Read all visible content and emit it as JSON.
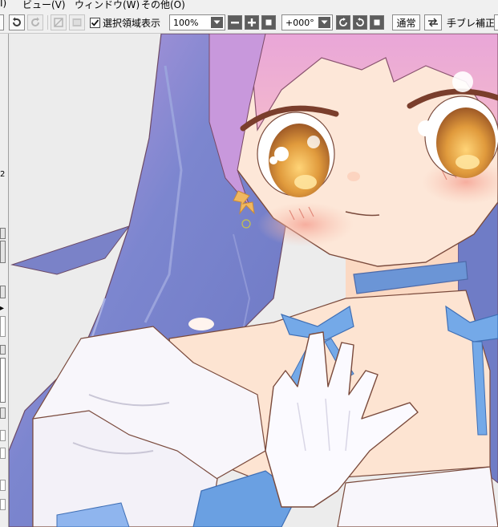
{
  "menu": {
    "items": [
      {
        "label": "Ⅰ)"
      },
      {
        "label": "ビュー(V)"
      },
      {
        "label": "ウィンドウ(W)"
      },
      {
        "label": "その他(O)"
      }
    ]
  },
  "toolbar": {
    "selection_checkbox_checked": true,
    "selection_label": "選択領域表示",
    "zoom_value": "100%",
    "rotation_value": "+000°",
    "blend_mode_label": "通常",
    "stabilizer_label": "手ブレ補正",
    "icons": [
      "undo-icon",
      "redo-icon",
      "clear-icon",
      "deselect-icon",
      "zoom-out-icon",
      "zoom-in-icon",
      "reset-zoom-icon",
      "rotate-left-icon",
      "rotate-right-icon",
      "reset-rotation-icon",
      "flip-horizontal-icon"
    ]
  },
  "left_panel": {
    "number_label": "2",
    "arrow_label": "▸"
  },
  "canvas": {
    "content": "anime-girl-illustration",
    "colors": {
      "background": "#eaeaea",
      "paper": "#ffffff",
      "hair_blue": "#6f7cc6",
      "hair_pink": "#d49ad6",
      "skin": "#fde7d8",
      "blush": "#f6b2a2",
      "eye_iris": "#d98d3a",
      "ribbon": "#6aa0e2",
      "choker": "#6b95d6",
      "glove": "#f9f8fd",
      "line": "#7a4a3c"
    }
  }
}
